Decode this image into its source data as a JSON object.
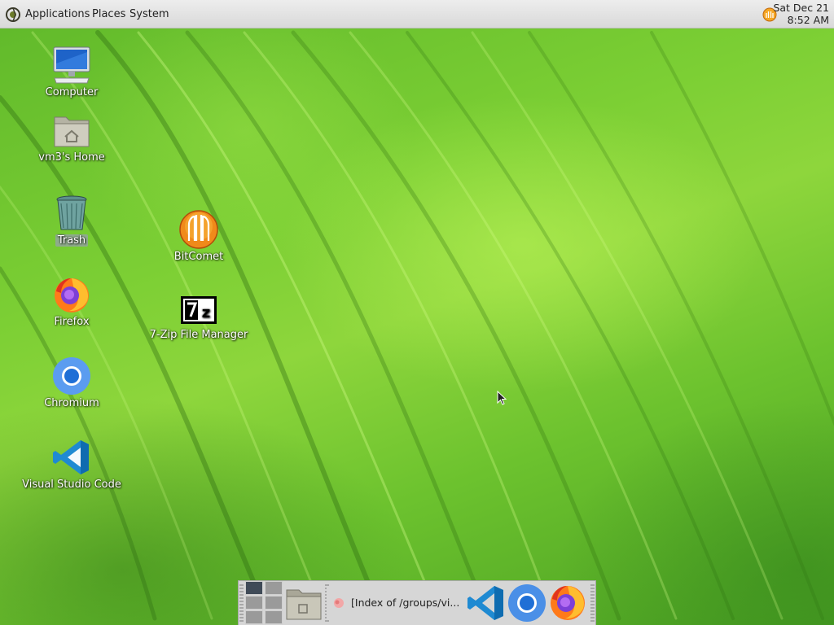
{
  "top_panel": {
    "menus": [
      "Applications",
      "Places",
      "System"
    ],
    "clock": {
      "date": "Sat Dec 21",
      "time": "8:52 AM"
    }
  },
  "desktop_icons": [
    {
      "label": "Computer",
      "icon": "computer-icon"
    },
    {
      "label": "vm3's Home",
      "icon": "home-folder-icon"
    },
    {
      "label": "Trash",
      "icon": "trash-icon"
    },
    {
      "label": "Firefox",
      "icon": "firefox-icon"
    },
    {
      "label": "Chromium",
      "icon": "chromium-icon"
    },
    {
      "label": "Visual Studio Code",
      "icon": "vscode-icon"
    },
    {
      "label": "BitComet",
      "icon": "bitcomet-icon"
    },
    {
      "label": "7-Zip File Manager",
      "icon": "7zip-icon"
    }
  ],
  "taskbar": {
    "task_label": "[Index of /groups/vi...",
    "launchers": [
      "files-launcher-icon",
      "vscode-launcher-icon",
      "chromium-launcher-icon",
      "firefox-launcher-icon"
    ]
  },
  "colors": {
    "panel": "#d9d9d9",
    "wallpaper_green": "#7ccf34",
    "vscode_blue": "#1f8ad2",
    "chromium_blue": "#4a8fe7",
    "firefox_orange": "#ff7a1a",
    "bitcomet_orange": "#f08a1a"
  }
}
